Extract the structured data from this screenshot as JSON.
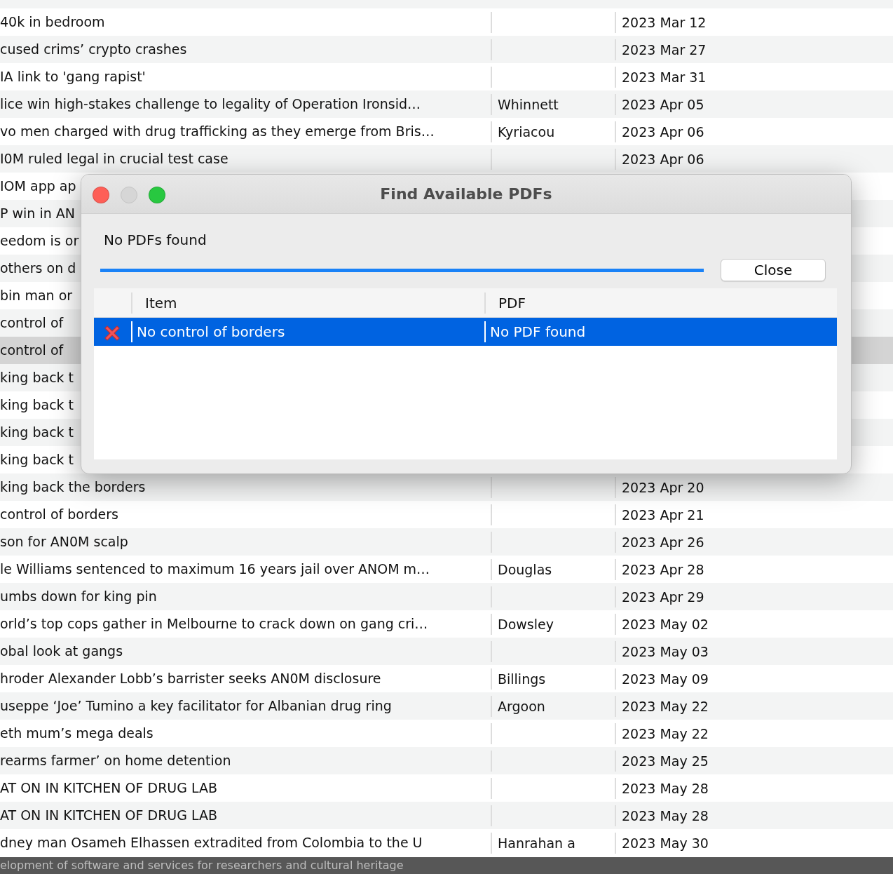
{
  "background_table": {
    "rows": [
      {
        "title": "40k in bedroom",
        "date": "2023 Mar 12",
        "selected": false
      },
      {
        "title": "cused crims’ crypto crashes",
        "date": "2023 Mar 27",
        "selected": false
      },
      {
        "title": "IA link to 'gang rapist'",
        "date": "2023 Mar 31",
        "selected": false
      },
      {
        "title": "lice win high-stakes challenge to legality of Operation Ironsid…",
        "creator": "Whinnett",
        "date": "2023 Apr 05",
        "selected": false
      },
      {
        "title": "vo men charged with drug trafficking as they emerge from Bris…",
        "creator": "Kyriacou",
        "date": "2023 Apr 06",
        "selected": false
      },
      {
        "title": "I0M ruled legal in crucial test case",
        "date": "2023 Apr 06",
        "selected": false
      },
      {
        "title": "IOM app ap",
        "selected": false
      },
      {
        "title": "P win in AN",
        "selected": false
      },
      {
        "title": "eedom is or",
        "selected": false
      },
      {
        "title": "others on d",
        "selected": false
      },
      {
        "title": "bin man or",
        "selected": false
      },
      {
        "title": "control of",
        "selected": false
      },
      {
        "title": "control of",
        "selected": true
      },
      {
        "title": "king back t",
        "selected": false
      },
      {
        "title": "king back t",
        "selected": false
      },
      {
        "title": "king back t",
        "selected": false
      },
      {
        "title": "king back t",
        "selected": false
      },
      {
        "title": "king back the borders",
        "date": "2023 Apr 20",
        "selected": false
      },
      {
        "title": "control of borders",
        "date": "2023 Apr 21",
        "selected": false
      },
      {
        "title": "son for AN0M scalp",
        "date": "2023 Apr 26",
        "selected": false
      },
      {
        "title": "le Williams sentenced to maximum 16 years jail over ANOM m…",
        "creator": "Douglas",
        "date": "2023 Apr 28",
        "selected": false
      },
      {
        "title": "umbs down for king pin",
        "date": "2023 Apr 29",
        "selected": false
      },
      {
        "title": "orld’s top cops gather in Melbourne to crack down on gang cri…",
        "creator": "Dowsley",
        "date": "2023 May 02",
        "selected": false
      },
      {
        "title": "obal look at gangs",
        "date": "2023 May 03",
        "selected": false
      },
      {
        "title": "hroder Alexander Lobb’s barrister seeks AN0M disclosure",
        "creator": "Billings",
        "date": "2023 May 09",
        "selected": false
      },
      {
        "title": "useppe ‘Joe’ Tumino a key facilitator for Albanian drug ring",
        "creator": "Argoon",
        "date": "2023 May 22",
        "selected": false
      },
      {
        "title": "eth mum’s mega deals",
        "date": "2023 May 22",
        "selected": false
      },
      {
        "title": "rearms farmer’ on home detention",
        "date": "2023 May 25",
        "selected": false
      },
      {
        "title": "AT ON IN KITCHEN OF DRUG LAB",
        "date": "2023 May 28",
        "selected": false
      },
      {
        "title": "AT ON IN KITCHEN OF DRUG LAB",
        "date": "2023 May 28",
        "selected": false
      },
      {
        "title": "dney man Osameh Elhassen extradited from Colombia to the U",
        "creator": "Hanrahan a",
        "date": "2023 May 30",
        "selected": false
      }
    ]
  },
  "dialog": {
    "title": "Find Available PDFs",
    "window_buttons": [
      {
        "kind": "close",
        "disabled": false
      },
      {
        "kind": "minimize",
        "disabled": true
      },
      {
        "kind": "zoom",
        "disabled": false
      }
    ],
    "message": "No PDFs found",
    "progress": {
      "level": 1
    },
    "close_button": "Close",
    "columns": [
      "Item",
      "PDF"
    ],
    "rows": [
      {
        "found": false,
        "item": "No control of borders",
        "pdf": "No PDF found",
        "selected": true
      }
    ]
  },
  "banner": "elopment of software and services for researchers and cultural heritage"
}
